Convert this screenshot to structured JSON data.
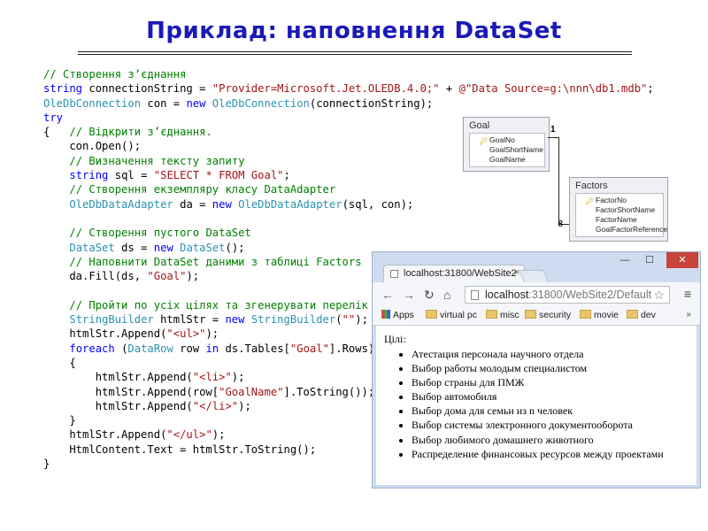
{
  "slide": {
    "title": "Приклад: наповнення DataSet"
  },
  "code": {
    "lines": [
      [
        {
          "t": "cm",
          "v": "// Створення з’єднання"
        }
      ],
      [
        {
          "t": "kw",
          "v": "string"
        },
        {
          "t": "tx",
          "v": " connectionString = "
        },
        {
          "t": "st",
          "v": "\"Provider=Microsoft.Jet.OLEDB.4.0;\""
        },
        {
          "t": "tx",
          "v": " + "
        },
        {
          "t": "st",
          "v": "@\"Data Source=g:\\nnn\\db1.mdb\""
        },
        {
          "t": "tx",
          "v": ";"
        }
      ],
      [
        {
          "t": "ty",
          "v": "OleDbConnection"
        },
        {
          "t": "tx",
          "v": " con = "
        },
        {
          "t": "kw",
          "v": "new"
        },
        {
          "t": "tx",
          "v": " "
        },
        {
          "t": "ty",
          "v": "OleDbConnection"
        },
        {
          "t": "tx",
          "v": "(connectionString);"
        }
      ],
      [
        {
          "t": "kw",
          "v": "try"
        }
      ],
      [
        {
          "t": "tx",
          "v": "{   "
        },
        {
          "t": "cm",
          "v": "// Відкрити з’єднання."
        }
      ],
      [
        {
          "t": "tx",
          "v": "    con.Open();"
        }
      ],
      [
        {
          "t": "tx",
          "v": "    "
        },
        {
          "t": "cm",
          "v": "// Визначення тексту запиту"
        }
      ],
      [
        {
          "t": "tx",
          "v": "    "
        },
        {
          "t": "kw",
          "v": "string"
        },
        {
          "t": "tx",
          "v": " sql = "
        },
        {
          "t": "st",
          "v": "\"SELECT * FROM Goal\""
        },
        {
          "t": "tx",
          "v": ";"
        }
      ],
      [
        {
          "t": "tx",
          "v": "    "
        },
        {
          "t": "cm",
          "v": "// Створення екземпляру класу DataAdapter"
        }
      ],
      [
        {
          "t": "tx",
          "v": "    "
        },
        {
          "t": "ty",
          "v": "OleDbDataAdapter"
        },
        {
          "t": "tx",
          "v": " da = "
        },
        {
          "t": "kw",
          "v": "new"
        },
        {
          "t": "tx",
          "v": " "
        },
        {
          "t": "ty",
          "v": "OleDbDataAdapter"
        },
        {
          "t": "tx",
          "v": "(sql, con);"
        }
      ],
      [
        {
          "t": "tx",
          "v": ""
        }
      ],
      [
        {
          "t": "tx",
          "v": "    "
        },
        {
          "t": "cm",
          "v": "// Створення пустого DataSet"
        }
      ],
      [
        {
          "t": "tx",
          "v": "    "
        },
        {
          "t": "ty",
          "v": "DataSet"
        },
        {
          "t": "tx",
          "v": " ds = "
        },
        {
          "t": "kw",
          "v": "new"
        },
        {
          "t": "tx",
          "v": " "
        },
        {
          "t": "ty",
          "v": "DataSet"
        },
        {
          "t": "tx",
          "v": "();"
        }
      ],
      [
        {
          "t": "tx",
          "v": "    "
        },
        {
          "t": "cm",
          "v": "// Наповнити DataSet даними з таблиці Factors"
        }
      ],
      [
        {
          "t": "tx",
          "v": "    da.Fill(ds, "
        },
        {
          "t": "st",
          "v": "\"Goal\""
        },
        {
          "t": "tx",
          "v": ");"
        }
      ],
      [
        {
          "t": "tx",
          "v": ""
        }
      ],
      [
        {
          "t": "tx",
          "v": "    "
        },
        {
          "t": "cm",
          "v": "// Пройти по усіх цілях та згенерувати перелік"
        }
      ],
      [
        {
          "t": "tx",
          "v": "    "
        },
        {
          "t": "ty",
          "v": "StringBuilder"
        },
        {
          "t": "tx",
          "v": " htmlStr = "
        },
        {
          "t": "kw",
          "v": "new"
        },
        {
          "t": "tx",
          "v": " "
        },
        {
          "t": "ty",
          "v": "StringBuilder"
        },
        {
          "t": "tx",
          "v": "("
        },
        {
          "t": "st",
          "v": "\"\""
        },
        {
          "t": "tx",
          "v": ");"
        }
      ],
      [
        {
          "t": "tx",
          "v": "    htmlStr.Append("
        },
        {
          "t": "st",
          "v": "\"<ul>\""
        },
        {
          "t": "tx",
          "v": ");"
        }
      ],
      [
        {
          "t": "tx",
          "v": "    "
        },
        {
          "t": "kw",
          "v": "foreach"
        },
        {
          "t": "tx",
          "v": " ("
        },
        {
          "t": "ty",
          "v": "DataRow"
        },
        {
          "t": "tx",
          "v": " row "
        },
        {
          "t": "kw",
          "v": "in"
        },
        {
          "t": "tx",
          "v": " ds.Tables["
        },
        {
          "t": "st",
          "v": "\"Goal\""
        },
        {
          "t": "tx",
          "v": "].Rows)"
        }
      ],
      [
        {
          "t": "tx",
          "v": "    {"
        }
      ],
      [
        {
          "t": "tx",
          "v": "        htmlStr.Append("
        },
        {
          "t": "st",
          "v": "\"<li>\""
        },
        {
          "t": "tx",
          "v": ");"
        }
      ],
      [
        {
          "t": "tx",
          "v": "        htmlStr.Append(row["
        },
        {
          "t": "st",
          "v": "\"GoalName\""
        },
        {
          "t": "tx",
          "v": "].ToString());"
        }
      ],
      [
        {
          "t": "tx",
          "v": "        htmlStr.Append("
        },
        {
          "t": "st",
          "v": "\"</li>\""
        },
        {
          "t": "tx",
          "v": ");"
        }
      ],
      [
        {
          "t": "tx",
          "v": "    }"
        }
      ],
      [
        {
          "t": "tx",
          "v": "    htmlStr.Append("
        },
        {
          "t": "st",
          "v": "\"</ul>\""
        },
        {
          "t": "tx",
          "v": ");"
        }
      ],
      [
        {
          "t": "tx",
          "v": "    HtmlContent.Text = htmlStr.ToString();"
        }
      ],
      [
        {
          "t": "tx",
          "v": "}"
        }
      ]
    ]
  },
  "diagram": {
    "goal": {
      "title": "Goal",
      "fields": [
        "GoalNo",
        "GoalShortName",
        "GoalName"
      ]
    },
    "factors": {
      "title": "Factors",
      "fields": [
        "FactorNo",
        "FactorShortName",
        "FactorName",
        "GoalFactorReference"
      ]
    },
    "rel_one": "1",
    "rel_many": "∞"
  },
  "browser": {
    "tab_title": "localhost:31800/WebSite2",
    "tab_close": "×",
    "win_min": "—",
    "win_max": "☐",
    "win_close": "✕",
    "url_host": "localhost",
    "url_path": ":31800/WebSite2/Default",
    "bookmarks": [
      "Apps",
      "virtual pc",
      "misc",
      "security",
      "movie",
      "dev"
    ],
    "bookmarks_more": "»",
    "page_label": "Цілі:",
    "goals": [
      "Атестация персонала научного отдела",
      "Выбор работы молодым специалистом",
      "Выбор страны для ПМЖ",
      "Выбор автомобиля",
      "Выбор дома для семьи из n человек",
      "Выбор системы электронного документооборота",
      "Выбор любимого домашнего животного",
      "Распределение финансовых ресурсов между проектами"
    ]
  },
  "colors": {
    "title": "#1a1ab8",
    "keyword": "#0000ff",
    "type": "#2b91af",
    "comment": "#008000",
    "string": "#a31515",
    "window_close": "#c7443a"
  },
  "icons": {
    "back": "back-arrow-icon",
    "forward": "forward-arrow-icon",
    "reload": "reload-icon",
    "home": "home-icon",
    "bookmark": "star-icon",
    "menu": "hamburger-menu-icon",
    "folder": "folder-icon",
    "key": "key-icon"
  }
}
